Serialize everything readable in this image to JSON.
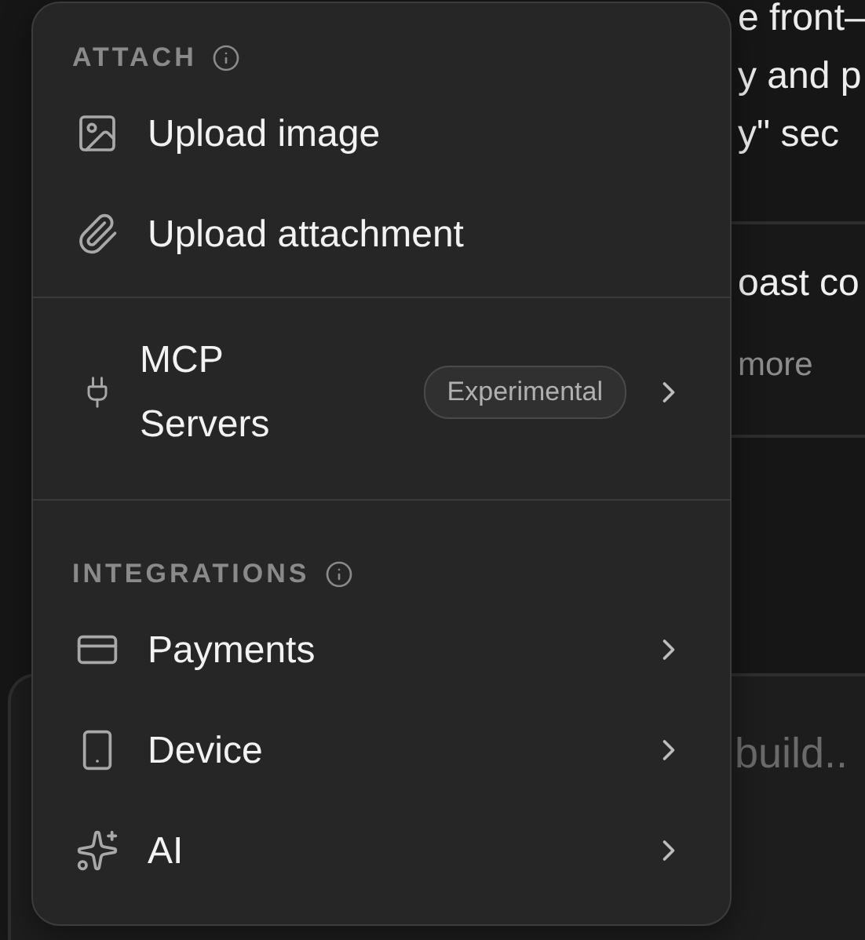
{
  "background": {
    "lines": [
      "e front–",
      "y and p",
      "y\" sec"
    ],
    "card": {
      "title": "oast co",
      "meta": "more"
    },
    "composer": {
      "text": "build.."
    }
  },
  "menu": {
    "sections": [
      {
        "heading": "ATTACH",
        "info": true,
        "items": [
          {
            "kind": "image",
            "label": "Upload image",
            "submenu": false
          },
          {
            "kind": "attachment",
            "label": "Upload attachment",
            "submenu": false
          }
        ]
      },
      {
        "items": [
          {
            "kind": "plug",
            "label": "MCP Servers",
            "badge": "Experimental",
            "submenu": true
          }
        ]
      },
      {
        "heading": "INTEGRATIONS",
        "info": true,
        "items": [
          {
            "kind": "card",
            "label": "Payments",
            "submenu": true
          },
          {
            "kind": "device",
            "label": "Device",
            "submenu": true
          },
          {
            "kind": "sparkles",
            "label": "AI",
            "submenu": true
          }
        ]
      }
    ]
  }
}
